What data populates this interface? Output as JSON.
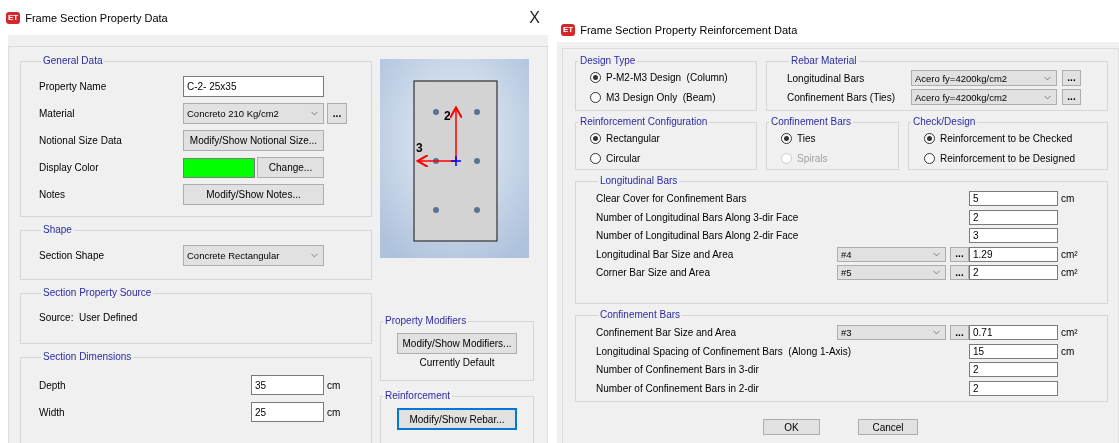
{
  "left_dialog": {
    "app_badge": "ET",
    "title": "Frame Section Property Data",
    "close": "X",
    "general_data": {
      "title": "General Data",
      "rows": [
        {
          "kind": "text",
          "label": "Property Name",
          "value": "C-2- 25x35"
        },
        {
          "kind": "select",
          "label": "Material",
          "value": "Concreto 210 Kg/cm2",
          "more": "..."
        },
        {
          "kind": "button",
          "label": "Notional Size Data",
          "button": "Modify/Show Notional Size..."
        },
        {
          "kind": "color",
          "label": "Display Color",
          "color": "#00ff00",
          "button": "Change..."
        },
        {
          "kind": "button",
          "label": "Notes",
          "button": "Modify/Show Notes..."
        }
      ]
    },
    "shape": {
      "title": "Shape",
      "label": "Section Shape",
      "value": "Concrete Rectangular"
    },
    "property_source": {
      "title": "Section Property Source",
      "text": "Source:  User Defined"
    },
    "dimensions": {
      "title": "Section Dimensions",
      "rows": [
        {
          "label": "Depth",
          "value": "35",
          "unit": "cm"
        },
        {
          "label": "Width",
          "value": "25",
          "unit": "cm"
        }
      ]
    },
    "preview": {
      "axis_2": "2",
      "axis_3": "3"
    },
    "property_modifiers": {
      "title": "Property Modifiers",
      "button": "Modify/Show Modifiers...",
      "status": "Currently Default"
    },
    "reinforcement": {
      "title": "Reinforcement",
      "button": "Modify/Show Rebar...",
      "focused": true
    }
  },
  "right_dialog": {
    "app_badge": "ET",
    "title": "Frame Section Property Reinforcement Data",
    "design_type": {
      "title": "Design Type",
      "options": [
        {
          "label": "P-M2-M3 Design  (Column)",
          "selected": true
        },
        {
          "label": "M3 Design Only  (Beam)",
          "selected": false
        }
      ]
    },
    "rebar_material": {
      "title": "Rebar Material",
      "rows": [
        {
          "label": "Longitudinal Bars",
          "value": "Acero fy=4200kg/cm2",
          "more": "..."
        },
        {
          "label": "Confinement Bars (Ties)",
          "value": "Acero fy=4200kg/cm2",
          "more": "..."
        }
      ]
    },
    "reinforcement_configuration": {
      "title": "Reinforcement Configuration",
      "options": [
        {
          "label": "Rectangular",
          "selected": true,
          "disabled": false
        },
        {
          "label": "Circular",
          "selected": false,
          "disabled": false
        }
      ]
    },
    "confinement_type": {
      "title": "Confinement Bars",
      "options": [
        {
          "label": "Ties",
          "selected": true,
          "disabled": false
        },
        {
          "label": "Spirals",
          "selected": false,
          "disabled": true
        }
      ]
    },
    "check_design": {
      "title": "Check/Design",
      "options": [
        {
          "label": "Reinforcement to be Checked",
          "selected": true,
          "disabled": false
        },
        {
          "label": "Reinforcement to be Designed",
          "selected": false,
          "disabled": false
        }
      ]
    },
    "longitudinal_bars": {
      "title": "Longitudinal Bars",
      "rows": [
        {
          "kind": "input",
          "label": "Clear Cover for Confinement Bars",
          "value": "5",
          "unit": "cm"
        },
        {
          "kind": "input",
          "label": "Number of Longitudinal Bars Along 3-dir Face",
          "value": "2"
        },
        {
          "kind": "input",
          "label": "Number of Longitudinal Bars Along 2-dir Face",
          "value": "3"
        },
        {
          "kind": "size",
          "label": "Longitudinal Bar Size and Area",
          "size": "#4",
          "more": "...",
          "value": "1.29",
          "unit": "cm²"
        },
        {
          "kind": "size",
          "label": "Corner Bar Size and Area",
          "size": "#5",
          "more": "...",
          "value": "2",
          "unit": "cm²"
        }
      ]
    },
    "confinement_bars": {
      "title": "Confinement Bars",
      "rows": [
        {
          "kind": "size",
          "label": "Confinement Bar Size and Area",
          "size": "#3",
          "more": "...",
          "value": "0.71",
          "unit": "cm²"
        },
        {
          "kind": "input",
          "label": "Longitudinal Spacing of Confinement Bars  (Along 1-Axis)",
          "value": "15",
          "unit": "cm"
        },
        {
          "kind": "input",
          "label": "Number of Confinement Bars in 3-dir",
          "value": "2"
        },
        {
          "kind": "input",
          "label": "Number of Confinement Bars in 2-dir",
          "value": "2"
        }
      ]
    },
    "buttons": [
      {
        "label": "OK"
      },
      {
        "label": "Cancel"
      }
    ]
  }
}
